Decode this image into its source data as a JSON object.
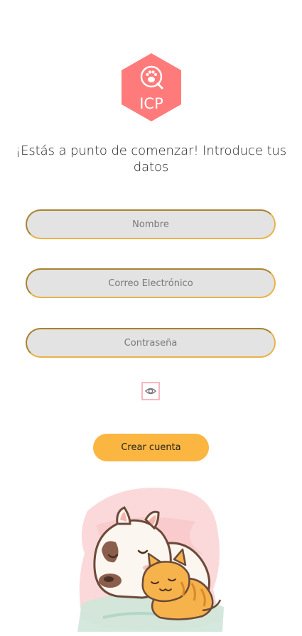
{
  "logo": {
    "text": "ICP",
    "color": "#ff7b7b"
  },
  "heading": "¡Estás a punto de comenzar! Introduce tus datos",
  "form": {
    "name_placeholder": "Nombre",
    "email_placeholder": "Correo Electrónico",
    "password_placeholder": "Contraseña",
    "toggle_icon": "eye-icon",
    "submit_label": "Crear cuenta"
  },
  "colors": {
    "accent": "#fbb642",
    "field_bg": "#e3e3e3",
    "field_border": "#e8b24a",
    "eye_border": "#f6b8c2"
  },
  "illustration": "dog-and-cat-sleeping"
}
